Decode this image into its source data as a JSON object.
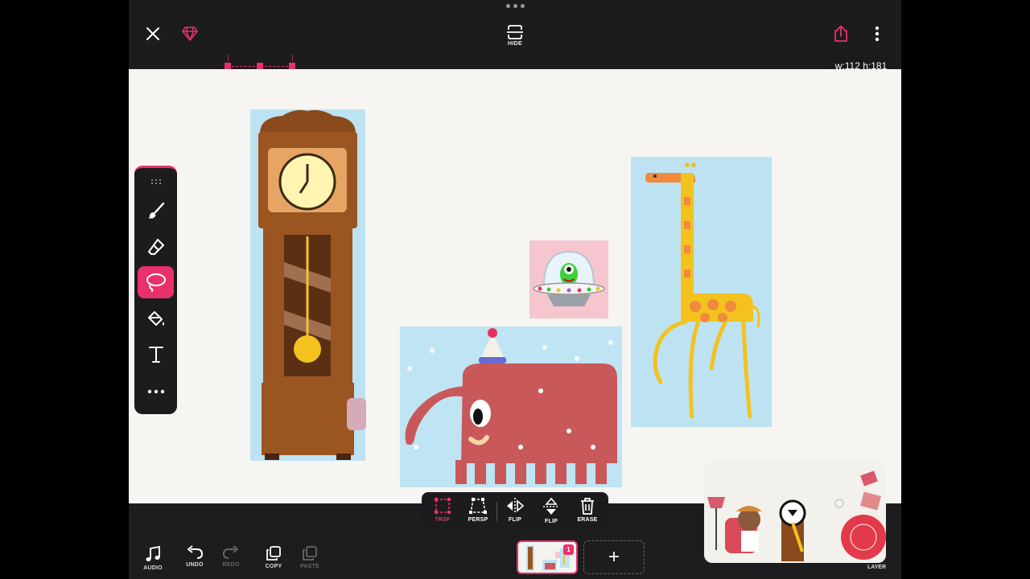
{
  "topbar": {
    "close_icon": "close-icon",
    "premium_icon": "gem-icon",
    "hide_label": "HIDE",
    "share_icon": "share-icon",
    "more_icon": "more-vertical-icon",
    "selection_size": "w:112 h:181"
  },
  "toolbar": {
    "tools": [
      {
        "name": "brush",
        "icon": "brush-icon",
        "active": false
      },
      {
        "name": "eraser",
        "icon": "eraser-icon",
        "active": false
      },
      {
        "name": "lasso",
        "icon": "lasso-icon",
        "active": true
      },
      {
        "name": "fill",
        "icon": "paint-bucket-icon",
        "active": false
      },
      {
        "name": "text",
        "icon": "text-icon",
        "active": false
      },
      {
        "name": "more",
        "icon": "more-horizontal-icon",
        "active": false
      }
    ]
  },
  "transform": {
    "trsf_label": "TRSF",
    "persp_label": "PERSP",
    "flip_h_label": "FLIP",
    "flip_v_label": "FLIP",
    "erase_label": "ERASE",
    "active": "TRSF"
  },
  "bottom": {
    "audio_label": "AUDIO",
    "undo_label": "UNDO",
    "redo_label": "REDO",
    "copy_label": "COPY",
    "paste_label": "PASTE",
    "frame_number": "1",
    "add_label": "+",
    "layer_label": "LAYER"
  },
  "colors": {
    "accent": "#e8306a",
    "panel": "#1c1c1e",
    "canvas": "#f6f5f2",
    "sticker_bg": "#bde3f3"
  }
}
